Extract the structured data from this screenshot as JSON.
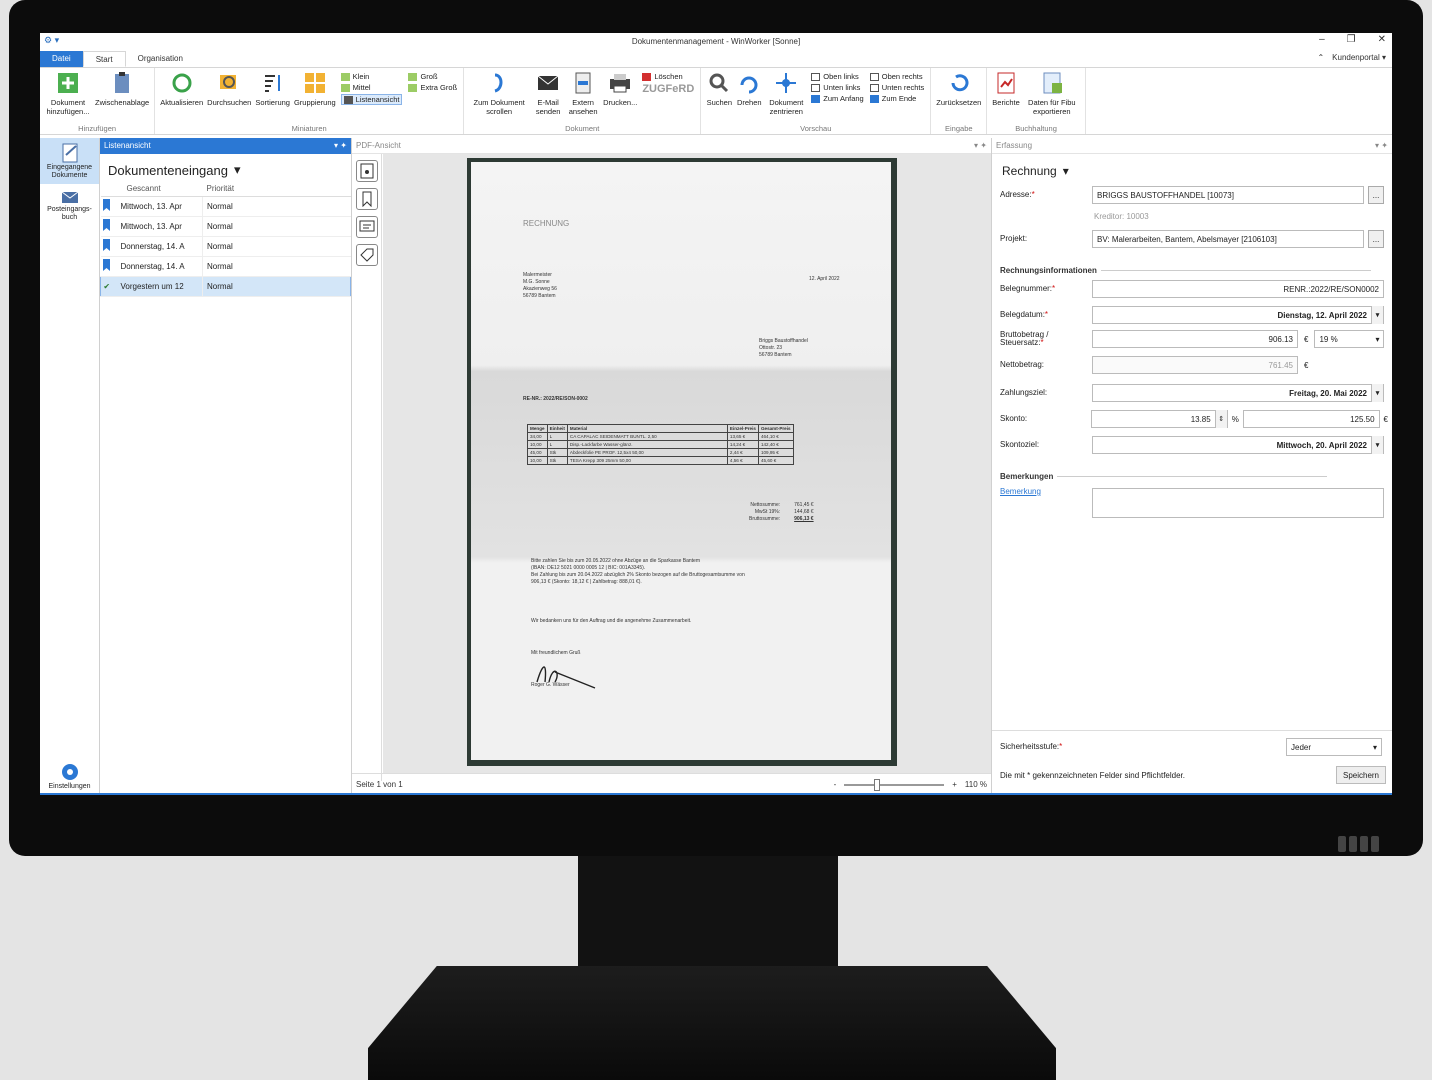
{
  "window": {
    "title": "Dokumentenmanagement - WinWorker [Sonne]",
    "quick_access": "⚙ ▾",
    "controls": [
      "–",
      "❐",
      "✕"
    ]
  },
  "tabs": [
    {
      "label": "Datei"
    },
    {
      "label": "Start"
    },
    {
      "label": "Organisation"
    }
  ],
  "tabs_right": {
    "up": "⌃",
    "portal": "Kundenportal ▾"
  },
  "ribbon": {
    "hinzufuegen": {
      "label": "Hinzufügen",
      "doc_add": "Dokument hinzufügen...",
      "clipboard": "Zwischenablage"
    },
    "miniaturen": {
      "label": "Miniaturen",
      "refresh": "Aktualisieren",
      "search": "Durchsuchen",
      "sort": "Sortierung",
      "group": "Gruppierung",
      "small": "Klein",
      "medium": "Mittel",
      "list": "Listenansicht",
      "large": "Groß",
      "xlarge": "Extra Groß"
    },
    "dokument": {
      "label": "Dokument",
      "scroll": "Zum Dokument scrollen",
      "email": "E-Mail senden",
      "external": "Extern ansehen",
      "print": "Drucken...",
      "delete": "Löschen",
      "zugferd": "ZUGFeRD"
    },
    "vorschau": {
      "label": "Vorschau",
      "find": "Suchen",
      "rotate": "Drehen",
      "center": "Dokument zentrieren",
      "top_left": "Oben links",
      "bottom_left": "Unten links",
      "to_start": "Zum Anfang",
      "top_right": "Oben rechts",
      "bottom_right": "Unten rechts",
      "to_end": "Zum Ende"
    },
    "eingabe": {
      "label": "Eingabe",
      "reset": "Zurücksetzen"
    },
    "buchhaltung": {
      "label": "Buchhaltung",
      "reports": "Berichte",
      "export": "Daten für Fibu exportieren"
    }
  },
  "nav": {
    "incoming": "Eingegangene Dokumente",
    "postbook": "Posteingangs-buch",
    "settings": "Einstellungen"
  },
  "list": {
    "pane_title": "Listenansicht",
    "pin": "▾ ✦",
    "heading": "Dokumenteneingang",
    "col_scanned": "Gescannt",
    "col_priority": "Priorität",
    "rows": [
      {
        "scanned": "Mittwoch, 13. Apr",
        "priority": "Normal",
        "mark": "bookmark"
      },
      {
        "scanned": "Mittwoch, 13. Apr",
        "priority": "Normal",
        "mark": "bookmark"
      },
      {
        "scanned": "Donnerstag, 14. A",
        "priority": "Normal",
        "mark": "bookmark"
      },
      {
        "scanned": "Donnerstag, 14. A",
        "priority": "Normal",
        "mark": "bookmark"
      },
      {
        "scanned": "Vorgestern um 12",
        "priority": "Normal",
        "mark": "check"
      }
    ]
  },
  "preview": {
    "pane_title": "PDF-Ansicht",
    "page_info": "Seite 1 von 1",
    "zoom": "110 %",
    "zoom_minus": "-",
    "zoom_plus": "+",
    "zoom_fraction": 0.3
  },
  "invoice": {
    "heading": "RECHNUNG",
    "sender": [
      "Malermeister",
      "M.G. Sonne",
      "Akazienweg 56",
      "56789 Bantem"
    ],
    "date": "12. April 2022",
    "recipient": [
      "Briggs Baustoffhandel",
      "Ottostr. 23",
      "56789 Bantem"
    ],
    "number": "RE-NR.: 2022/RE/SON-0002",
    "table_head": [
      "Menge",
      "Einheit",
      "Material",
      "Einzel-Preis",
      "Gesamt-Preis"
    ],
    "table_rows": [
      [
        "34,00",
        "L",
        "CA CAPALAC SEIDENMATT BUNTL. 2,50",
        "13,65 €",
        "464,10 €"
      ],
      [
        "10,00",
        "L",
        "Disp.-Lackfarbe Wasser-glänz.",
        "14,24 €",
        "142,40 €"
      ],
      [
        "45,00",
        "Stk",
        "Abdeckfolie PE PROF. 12,5x4 50,00",
        "2,44 €",
        "109,95 €"
      ],
      [
        "10,00",
        "Stk",
        "TESA Krepp 309 25mm 50,00",
        "4,56 €",
        "45,60 €"
      ]
    ],
    "totals": [
      [
        "Nettosumme:",
        "761,45 €"
      ],
      [
        "MwSt 19%:",
        "144,68 €"
      ],
      [
        "Bruttosumme:",
        "906,13 €"
      ]
    ],
    "payment": [
      "Bitte zahlen Sie bis zum 20.05.2022 ohne Abzüge an die Sparkasse Bantem",
      "(IBAN: DE12 5021 0000 0005 12 | BIC: 001A3345).",
      "Bei Zahlung bis zum 20.04.2022 abzüglich 2% Skonto bezogen auf die Bruttogesamtsumme von",
      "906,13 € (Skonto: 18,12 € | Zahlbetrag: 888,01 €)."
    ],
    "thanks": "Wir bedanken uns für den Auftrag und die angenehme Zusammenarbeit.",
    "greeting": "Mit freundlichem Gruß",
    "signer": "Roger G. Wässer"
  },
  "form": {
    "pane_title": "Erfassung",
    "doc_type": "Rechnung",
    "address_label": "Adresse:",
    "address": "BRIGGS BAUSTOFFHANDEL [10073]",
    "creditor": "Kreditor: 10003",
    "project_label": "Projekt:",
    "project": "BV: Malerarbeiten, Bantem, Abelsmayer [2106103]",
    "section_invoice": "Rechnungsinformationen",
    "docnum_label": "Belegnummer:",
    "docnum": "RENR.:2022/RE/SON0002",
    "docdate_label": "Belegdatum:",
    "docdate": "Dienstag, 12. April 2022",
    "gross_label": "Bruttobetrag / Steuersatz:",
    "gross": "906.13",
    "currency": "€",
    "tax": "19 %",
    "net_label": "Nettobetrag:",
    "net": "761.45",
    "due_label": "Zahlungsziel:",
    "due": "Freitag, 20. Mai 2022",
    "discount_label": "Skonto:",
    "discount_pct": "13.85",
    "pct": "%",
    "discount_amount": "125.50",
    "discount_due_label": "Skontoziel:",
    "discount_due": "Mittwoch, 20. April 2022",
    "section_notes": "Bemerkungen",
    "note_link": "Bemerkung",
    "security_label": "Sicherheitsstufe:",
    "security": "Jeder",
    "footer_note": "Die mit * gekennzeichneten Felder sind Pflichtfelder.",
    "save": "Speichern"
  },
  "colors": {
    "accent": "#2b78d4",
    "required": "#d01010",
    "selection": "#d3e6f8"
  }
}
